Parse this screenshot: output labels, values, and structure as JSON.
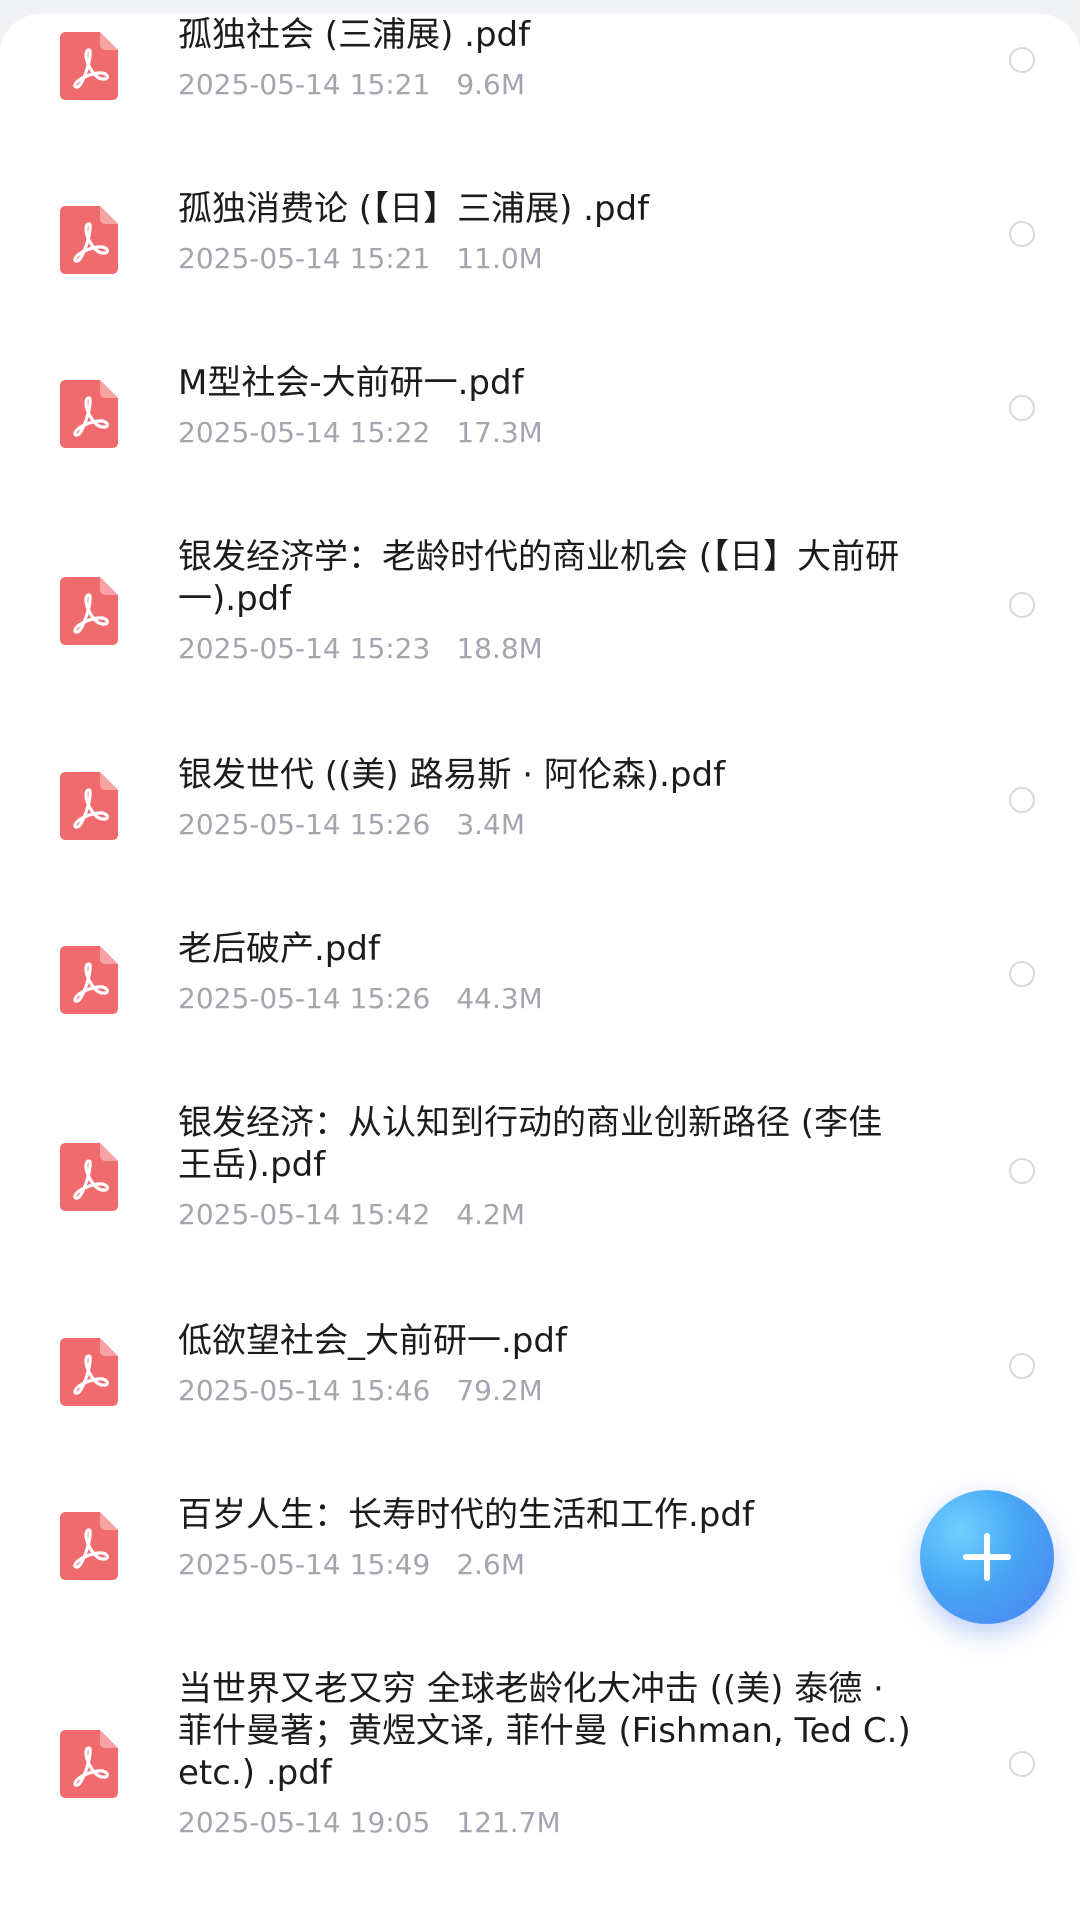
{
  "files": [
    {
      "name": "孤独社会 (三浦展) .pdf",
      "date": "2025-05-14 15:21",
      "size": "9.6M",
      "icon": "pdf-file-icon"
    },
    {
      "name": "孤独消费论 (【日】三浦展) .pdf",
      "date": "2025-05-14 15:21",
      "size": "11.0M",
      "icon": "pdf-file-icon"
    },
    {
      "name": "M型社会-大前研一.pdf",
      "date": "2025-05-14 15:22",
      "size": "17.3M",
      "icon": "pdf-file-icon"
    },
    {
      "name": "银发经济学：老龄时代的商业机会 (【日】大前研一).pdf",
      "date": "2025-05-14 15:23",
      "size": "18.8M",
      "icon": "pdf-file-icon"
    },
    {
      "name": "银发世代 ((美) 路易斯 · 阿伦森).pdf",
      "date": "2025-05-14 15:26",
      "size": "3.4M",
      "icon": "pdf-file-icon"
    },
    {
      "name": "老后破产.pdf",
      "date": "2025-05-14 15:26",
      "size": "44.3M",
      "icon": "pdf-file-icon"
    },
    {
      "name": "银发经济：从认知到行动的商业创新路径 (李佳  王岳).pdf",
      "date": "2025-05-14 15:42",
      "size": "4.2M",
      "icon": "pdf-file-icon"
    },
    {
      "name": "低欲望社会_大前研一.pdf",
      "date": "2025-05-14 15:46",
      "size": "79.2M",
      "icon": "pdf-file-icon"
    },
    {
      "name": "百岁人生：长寿时代的生活和工作.pdf",
      "date": "2025-05-14 15:49",
      "size": "2.6M",
      "icon": "pdf-file-icon"
    },
    {
      "name": "当世界又老又穷 全球老龄化大冲击 ((美) 泰德 · 菲什曼著；黄煜文译, 菲什曼 (Fishman, Ted C.) etc.) .pdf",
      "date": "2025-05-14 19:05",
      "size": "121.7M",
      "icon": "pdf-file-icon"
    }
  ],
  "fab": {
    "icon": "plus-icon"
  },
  "colors": {
    "pdf_icon": "#f06b6e",
    "fab_start": "#6fd0ff",
    "fab_end": "#4b80f0",
    "meta_text": "#a3a6ae"
  }
}
